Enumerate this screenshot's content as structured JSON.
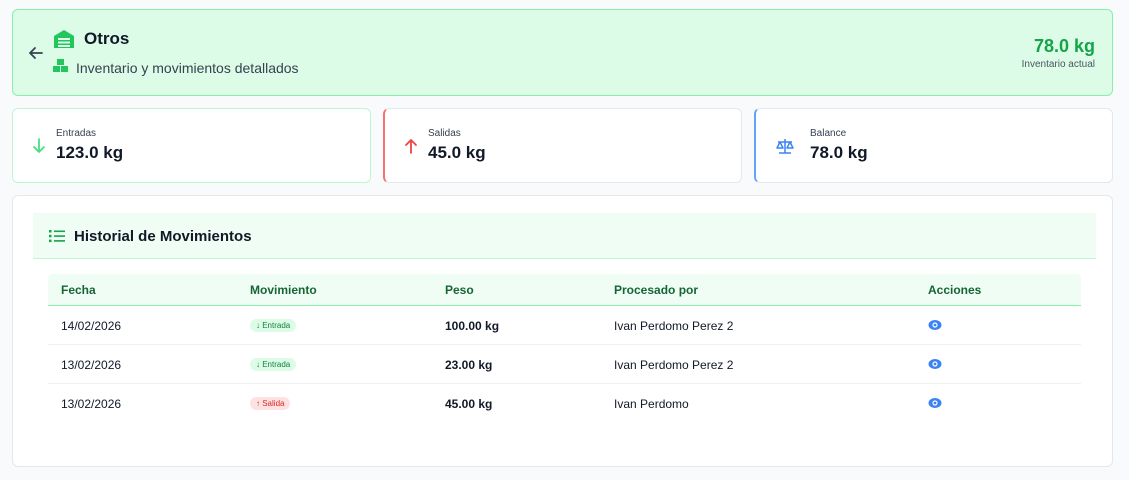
{
  "header": {
    "title": "Otros",
    "subtitle": "Inventario y movimientos detallados",
    "inventory_value": "78.0 kg",
    "inventory_label": "Inventario actual",
    "back_icon": "arrow-left-icon",
    "title_icon": "warehouse-icon",
    "subtitle_icon": "boxes-icon"
  },
  "stats": [
    {
      "label": "Entradas",
      "value": "123.0 kg",
      "icon": "arrow-down-icon",
      "color": "#4ade80"
    },
    {
      "label": "Salidas",
      "value": "45.0 kg",
      "icon": "arrow-up-icon",
      "color": "#ef4444"
    },
    {
      "label": "Balance",
      "value": "78.0 kg",
      "icon": "scale-icon",
      "color": "#3b82f6"
    }
  ],
  "history": {
    "title": "Historial de Movimientos",
    "icon": "list-icon",
    "columns": [
      "Fecha",
      "Movimiento",
      "Peso",
      "Procesado por",
      "Acciones"
    ],
    "rows": [
      {
        "fecha": "14/02/2026",
        "movimiento": "↓ Entrada",
        "tipo": "in",
        "peso": "100.00 kg",
        "procesado": "Ivan Perdomo Perez 2"
      },
      {
        "fecha": "13/02/2026",
        "movimiento": "↓ Entrada",
        "tipo": "in",
        "peso": "23.00 kg",
        "procesado": "Ivan Perdomo Perez 2"
      },
      {
        "fecha": "13/02/2026",
        "movimiento": "↑ Salida",
        "tipo": "out",
        "peso": "45.00 kg",
        "procesado": "Ivan Perdomo"
      }
    ]
  },
  "colors": {
    "accent": "#16a34a",
    "header_bg": "#dcfce7",
    "action_icon": "#3b82f6"
  }
}
